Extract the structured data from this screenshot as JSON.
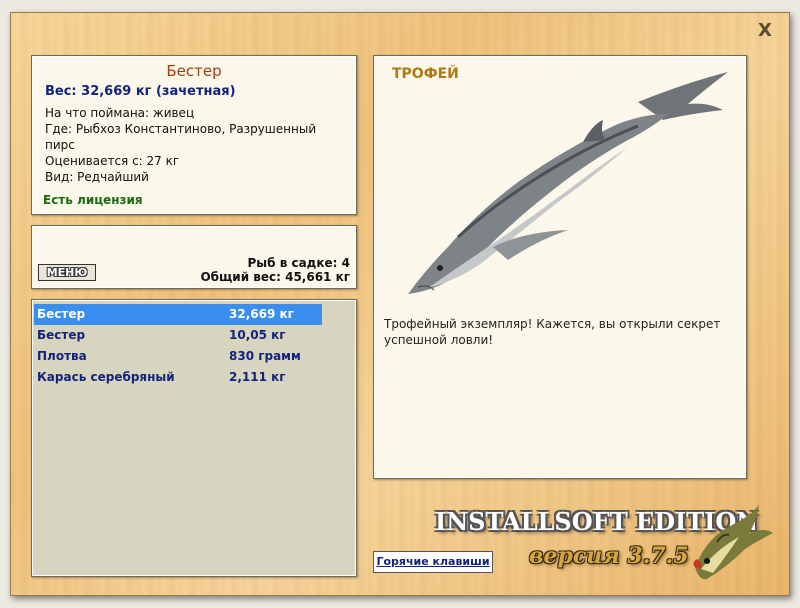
{
  "window": {
    "close_label": "X"
  },
  "fish_info": {
    "name": "Бестер",
    "weight_line": "Вес: 32,669 кг (зачетная)",
    "caught_on": "На что поймана: живец",
    "location": "Где: Рыбхоз Константиново, Разрушенный пирс",
    "valued_from": "Оценивается с: 27 кг",
    "kind": "Вид: Редчайший",
    "license": "Есть лицензия"
  },
  "keepnet": {
    "menu_label": "МЕНЮ",
    "count_line": "Рыб в садке: 4",
    "total_line": "Общий вес: 45,661 кг"
  },
  "catch_list": [
    {
      "name": "Бестер",
      "weight": "32,669 кг"
    },
    {
      "name": "Бестер",
      "weight": "10,05 кг"
    },
    {
      "name": "Плотва",
      "weight": "830 грамм"
    },
    {
      "name": "Карась серебряный",
      "weight": "2,111 кг"
    }
  ],
  "photo": {
    "trophy_label": "ТРОФЕЙ",
    "description": "Трофейный экземпляр! Кажется, вы открыли секрет успешной ловли!"
  },
  "footer": {
    "hotkeys_label": "Горячие клавиши",
    "brand": "INSTALLSOFT EDITION",
    "version": "версия 3.7.5"
  },
  "colors": {
    "selected_row": "#3a8ef0",
    "fish_name": "#a23b10",
    "weight_text": "#14237a",
    "license_text": "#1a6a12",
    "trophy_text": "#b07a10"
  }
}
